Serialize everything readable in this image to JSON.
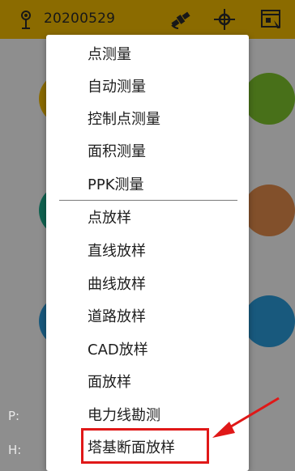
{
  "topbar": {
    "title": "20200529",
    "icons": [
      "antenna-icon",
      "satellite-icon",
      "crosshair-icon",
      "calculator-window-icon"
    ],
    "color": "#f0b800"
  },
  "background_circles": [
    {
      "color": "#f0b800"
    },
    {
      "color": "#7cc22c"
    },
    {
      "color": "#1aaa8a"
    },
    {
      "color": "#e08a4a"
    },
    {
      "color": "#2a9ad8"
    },
    {
      "color": "#2a9ad8"
    }
  ],
  "info": {
    "p_label": "P:",
    "h_label": "H:"
  },
  "menu": {
    "group1": [
      "点测量",
      "自动测量",
      "控制点测量",
      "面积测量",
      "PPK测量"
    ],
    "group2": [
      "点放样",
      "直线放样",
      "曲线放样",
      "道路放样",
      "CAD放样",
      "面放样",
      "电力线勘测",
      "塔基断面放样"
    ]
  },
  "highlight": {
    "item": "塔基断面放样",
    "color": "#e01818"
  }
}
